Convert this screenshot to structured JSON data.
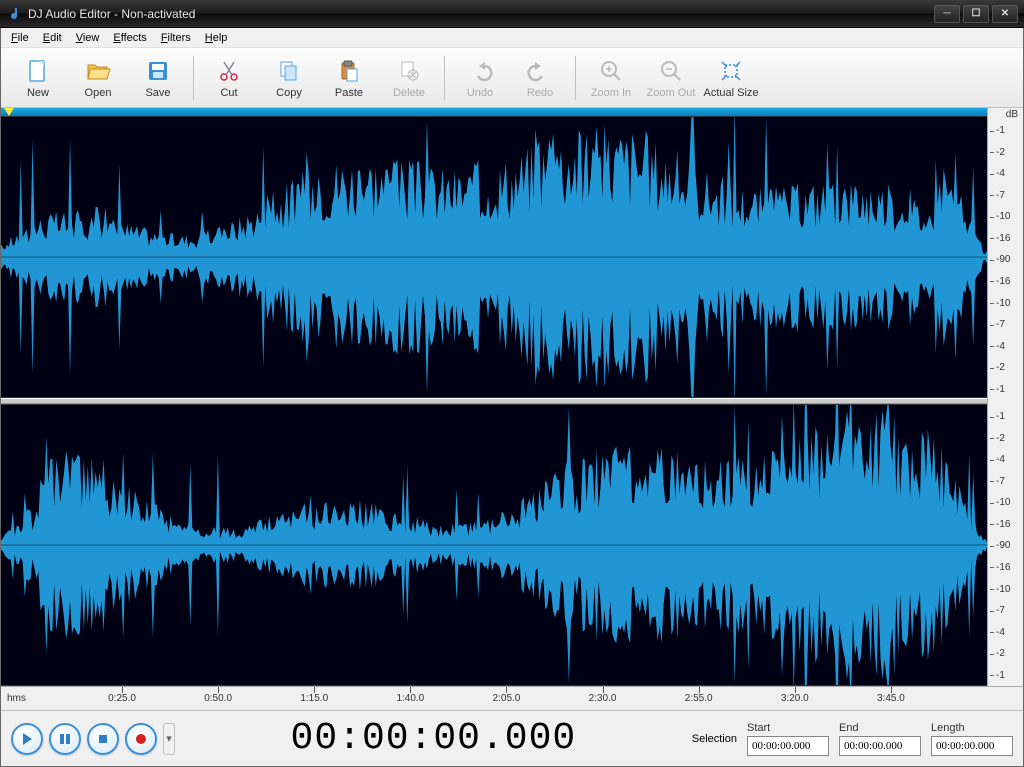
{
  "window": {
    "title": "DJ Audio Editor - Non-activated"
  },
  "menu": [
    "File",
    "Edit",
    "View",
    "Effects",
    "Filters",
    "Help"
  ],
  "toolbar": [
    {
      "id": "new",
      "label": "New",
      "enabled": true
    },
    {
      "id": "open",
      "label": "Open",
      "enabled": true
    },
    {
      "id": "save",
      "label": "Save",
      "enabled": true
    },
    {
      "sep": true
    },
    {
      "id": "cut",
      "label": "Cut",
      "enabled": true
    },
    {
      "id": "copy",
      "label": "Copy",
      "enabled": true
    },
    {
      "id": "paste",
      "label": "Paste",
      "enabled": true
    },
    {
      "id": "delete",
      "label": "Delete",
      "enabled": false
    },
    {
      "sep": true
    },
    {
      "id": "undo",
      "label": "Undo",
      "enabled": false
    },
    {
      "id": "redo",
      "label": "Redo",
      "enabled": false
    },
    {
      "sep": true
    },
    {
      "id": "zoomin",
      "label": "Zoom In",
      "enabled": false
    },
    {
      "id": "zoomout",
      "label": "Zoom Out",
      "enabled": false
    },
    {
      "id": "actual",
      "label": "Actual Size",
      "enabled": true
    }
  ],
  "timeline": {
    "unit_label": "hms",
    "ticks": [
      "0:25.0",
      "0:50.0",
      "1:15.0",
      "1:40.0",
      "2:05.0",
      "2:30.0",
      "2:55.0",
      "3:20.0",
      "3:45.0"
    ]
  },
  "db_scale": {
    "header": "dB",
    "values": [
      "-1",
      "-2",
      "-4",
      "-7",
      "-10",
      "-16",
      "-90",
      "-16",
      "-10",
      "-7",
      "-4",
      "-2",
      "-1"
    ]
  },
  "transport": {
    "timecode": "00:00:00.000"
  },
  "selection": {
    "label": "Selection",
    "start_label": "Start",
    "start_value": "00:00:00.000",
    "end_label": "End",
    "end_value": "00:00:00.000",
    "len_label": "Length",
    "len_value": "00:00:00.000"
  },
  "colors": {
    "waveform_fill": "#2196d4",
    "waveform_bg": "#000014",
    "ruler_blue": "#1aa8e8"
  }
}
